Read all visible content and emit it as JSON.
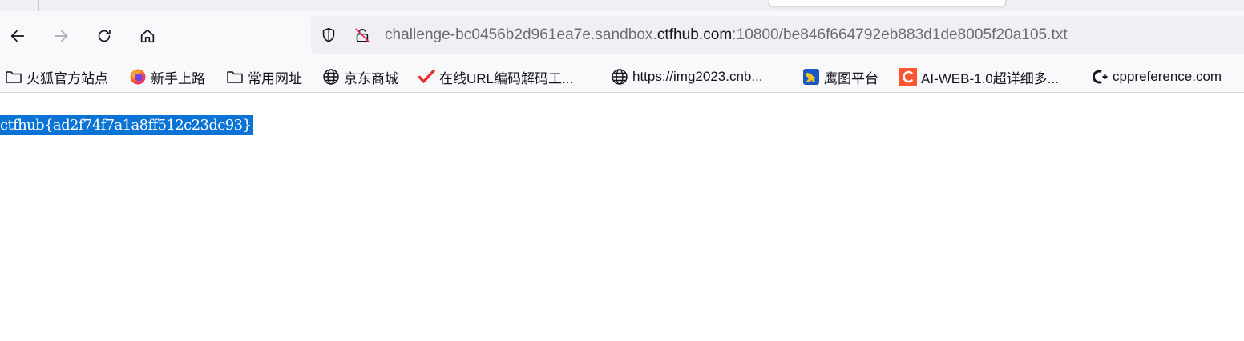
{
  "browser": {
    "url": {
      "prefix": "challenge-bc0456b2d961ea7e.sandbox.",
      "domain": "ctfhub.com",
      "suffix": ":10800/be846f664792eb883d1de8005f20a105.txt"
    },
    "nav_icons": [
      "back-arrow-icon",
      "forward-arrow-icon",
      "reload-icon",
      "home-icon"
    ],
    "urlbar_icons": [
      "shield-icon",
      "insecure-lock-icon"
    ]
  },
  "bookmarks": [
    {
      "label": "火狐官方站点",
      "icon": "folder-icon"
    },
    {
      "label": "新手上路",
      "icon": "firefox-icon"
    },
    {
      "label": "常用网址",
      "icon": "folder-icon"
    },
    {
      "label": "京东商城",
      "icon": "globe-icon"
    },
    {
      "label": "在线URL编码解码工...",
      "icon": "red-checkmark-icon"
    },
    {
      "label": "https://img2023.cnb...",
      "icon": "globe-icon"
    },
    {
      "label": "鹰图平台",
      "icon": "hunter-logo-icon"
    },
    {
      "label": "AI-WEB-1.0超详细多...",
      "icon": "csdn-c-icon"
    },
    {
      "label": "cppreference.com",
      "icon": "cpp-logo-icon"
    }
  ],
  "page": {
    "text": "ctfhub{ad2f74f7a1a8ff512c23dc93}",
    "selection_color": "#0a74d6"
  }
}
